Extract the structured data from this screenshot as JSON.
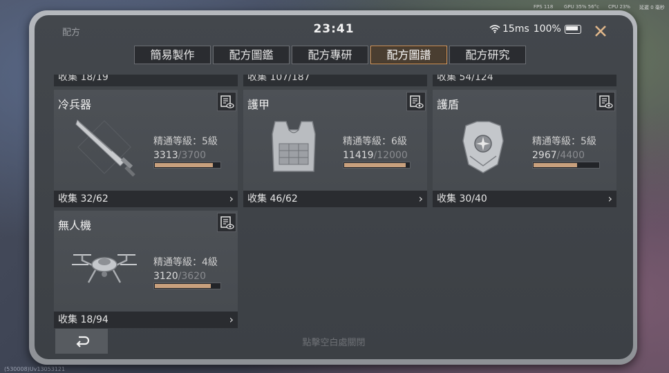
{
  "hud": {
    "fps": "FPS 118",
    "gpu": "GPU 35% 56°c",
    "cpu": "CPU 23%",
    "latency": "延遲 0 毫秒"
  },
  "debug_text": "(530008)Uv13053121",
  "status_bar": {
    "title": "配方",
    "time": "23:41",
    "ping": "15ms",
    "battery": "100%"
  },
  "tabs": [
    {
      "label": "簡易製作",
      "active": false
    },
    {
      "label": "配方圖鑑",
      "active": false
    },
    {
      "label": "配方專研",
      "active": false
    },
    {
      "label": "配方圖譜",
      "active": true
    },
    {
      "label": "配方研究",
      "active": false
    }
  ],
  "partial_row": [
    {
      "collect": "收集 18/19"
    },
    {
      "collect": "收集 107/187"
    },
    {
      "collect": "收集 54/124"
    }
  ],
  "cards": [
    {
      "title": "冷兵器",
      "icon": "melee-blade-icon",
      "mastery": "精通等級：5級",
      "exp_current": "3313",
      "exp_max": "/3700",
      "progress": 0.895,
      "collect": "收集 32/62"
    },
    {
      "title": "護甲",
      "icon": "armor-vest-icon",
      "mastery": "精通等級：6級",
      "exp_current": "11419",
      "exp_max": "/12000",
      "progress": 0.951,
      "collect": "收集 46/62"
    },
    {
      "title": "護盾",
      "icon": "shield-icon",
      "mastery": "精通等級：5級",
      "exp_current": "2967",
      "exp_max": "/4400",
      "progress": 0.674,
      "collect": "收集 30/40"
    },
    {
      "title": "無人機",
      "icon": "drone-icon",
      "mastery": "精通等級：4級",
      "exp_current": "3120",
      "exp_max": "/3620",
      "progress": 0.862,
      "collect": "收集 18/94"
    }
  ],
  "footer_hint": "點擊空白處關閉",
  "colors": {
    "accent": "#d79a5e",
    "progress_fill": "#c8a07d",
    "close": "#e0b68a"
  }
}
